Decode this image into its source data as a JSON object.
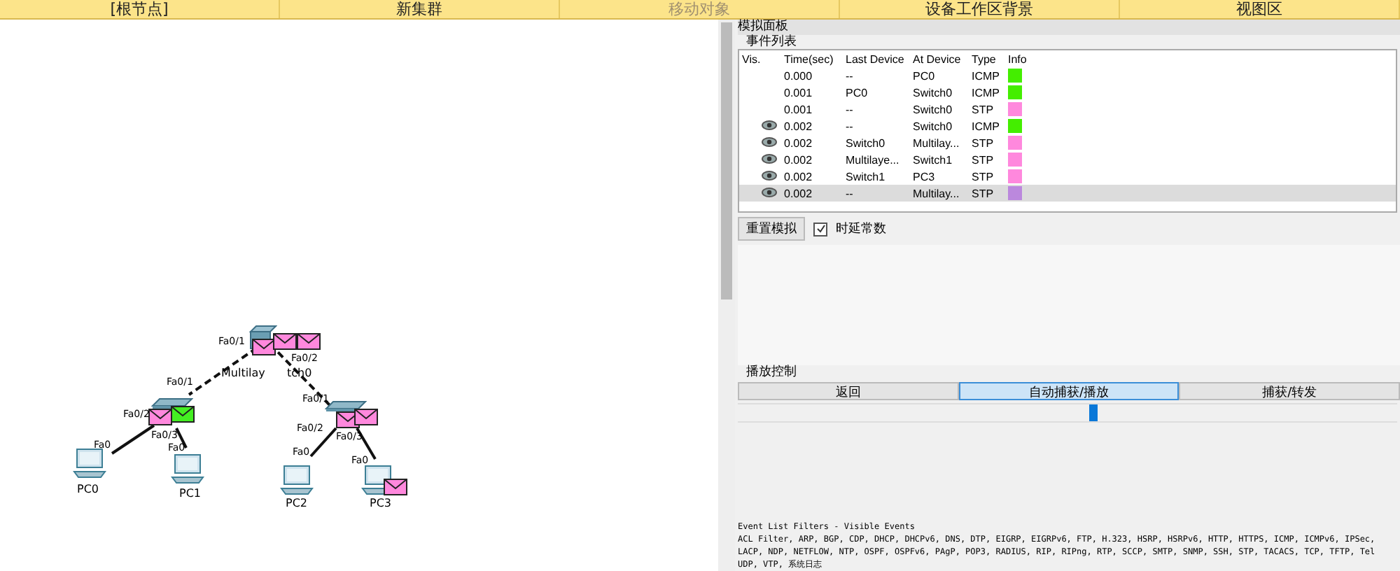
{
  "toolbar": [
    {
      "label": "[根节点]",
      "disabled": false
    },
    {
      "label": "新集群",
      "disabled": false
    },
    {
      "label": "移动对象",
      "disabled": true
    },
    {
      "label": "设备工作区背景",
      "disabled": false
    },
    {
      "label": "视图区",
      "disabled": false
    }
  ],
  "topology": {
    "devices": [
      {
        "kind": "multilayer"
      },
      {
        "kind": "switch"
      },
      {
        "kind": "switch"
      },
      {
        "kind": "pc",
        "label": "PC0"
      },
      {
        "kind": "pc",
        "label": "PC1"
      },
      {
        "kind": "pc",
        "label": "PC2"
      },
      {
        "kind": "pc",
        "label": "PC3"
      }
    ],
    "device_labels": [
      "Multilay",
      "tch0"
    ],
    "ports": [
      "Fa0/1",
      "Fa0/2",
      "Fa0/1",
      "Fa0/2",
      "Fa0/3",
      "Fa0",
      "Fa0",
      "Fa0/1",
      "Fa0/2",
      "Fa0/3",
      "Fa0",
      "Fa0"
    ],
    "links": [
      {
        "kind": "dashed"
      },
      {
        "kind": "dashed"
      },
      {
        "kind": "solid"
      },
      {
        "kind": "solid"
      },
      {
        "kind": "solid"
      },
      {
        "kind": "solid"
      }
    ],
    "packets": [
      {
        "color": "#ff88dd"
      },
      {
        "color": "#ff88dd"
      },
      {
        "color": "#ff88dd"
      },
      {
        "color": "#ff88dd"
      },
      {
        "color": "#44ee22"
      },
      {
        "color": "#ff88dd"
      },
      {
        "color": "#ff88dd"
      },
      {
        "color": "#ff88dd"
      }
    ]
  },
  "panel": {
    "title": "模拟面板",
    "event_list": {
      "title": "事件列表",
      "columns": [
        "Vis.",
        "Time(sec)",
        "Last Device",
        "At Device",
        "Type",
        "Info"
      ],
      "rows": [
        {
          "visible": false,
          "time": "0.000",
          "last": "--",
          "at": "PC0",
          "type": "ICMP",
          "color": "#44ee00",
          "selected": false
        },
        {
          "visible": false,
          "time": "0.001",
          "last": "PC0",
          "at": "Switch0",
          "type": "ICMP",
          "color": "#44ee00",
          "selected": false
        },
        {
          "visible": false,
          "time": "0.001",
          "last": "--",
          "at": "Switch0",
          "type": "STP",
          "color": "#ff88dd",
          "selected": false
        },
        {
          "visible": true,
          "time": "0.002",
          "last": "--",
          "at": "Switch0",
          "type": "ICMP",
          "color": "#44ee00",
          "selected": false
        },
        {
          "visible": true,
          "time": "0.002",
          "last": "Switch0",
          "at": "Multilay...",
          "type": "STP",
          "color": "#ff88dd",
          "selected": false
        },
        {
          "visible": true,
          "time": "0.002",
          "last": "Multilaye...",
          "at": "Switch1",
          "type": "STP",
          "color": "#ff88dd",
          "selected": false
        },
        {
          "visible": true,
          "time": "0.002",
          "last": "Switch1",
          "at": "PC3",
          "type": "STP",
          "color": "#ff88dd",
          "selected": false
        },
        {
          "visible": true,
          "time": "0.002",
          "last": "--",
          "at": "Multilay...",
          "type": "STP",
          "color": "#bb88dd",
          "selected": true
        }
      ]
    },
    "reset_button": "重置模拟",
    "constant_delay": {
      "label": "时延常数",
      "checked": true
    },
    "playback": {
      "title": "播放控制",
      "buttons": [
        {
          "label": "返回",
          "selected": false
        },
        {
          "label": "自动捕获/播放",
          "selected": true
        },
        {
          "label": "捕获/转发",
          "selected": false
        }
      ],
      "level": 0.54
    },
    "filters": {
      "title": "Event List Filters - Visible Events",
      "lines": [
        "ACL Filter, ARP, BGP, CDP, DHCP, DHCPv6, DNS, DTP, EIGRP, EIGRPv6, FTP, H.323, HSRP, HSRPv6, HTTP, HTTPS, ICMP, ICMPv6, IPSec,",
        "LACP, NDP, NETFLOW, NTP, OSPF, OSPFv6, PAgP, POP3, RADIUS, RIP, RIPng, RTP, SCCP, SMTP, SNMP, SSH, STP, TACACS, TCP, TFTP, Tel",
        "UDP, VTP, 系统日志"
      ]
    }
  }
}
